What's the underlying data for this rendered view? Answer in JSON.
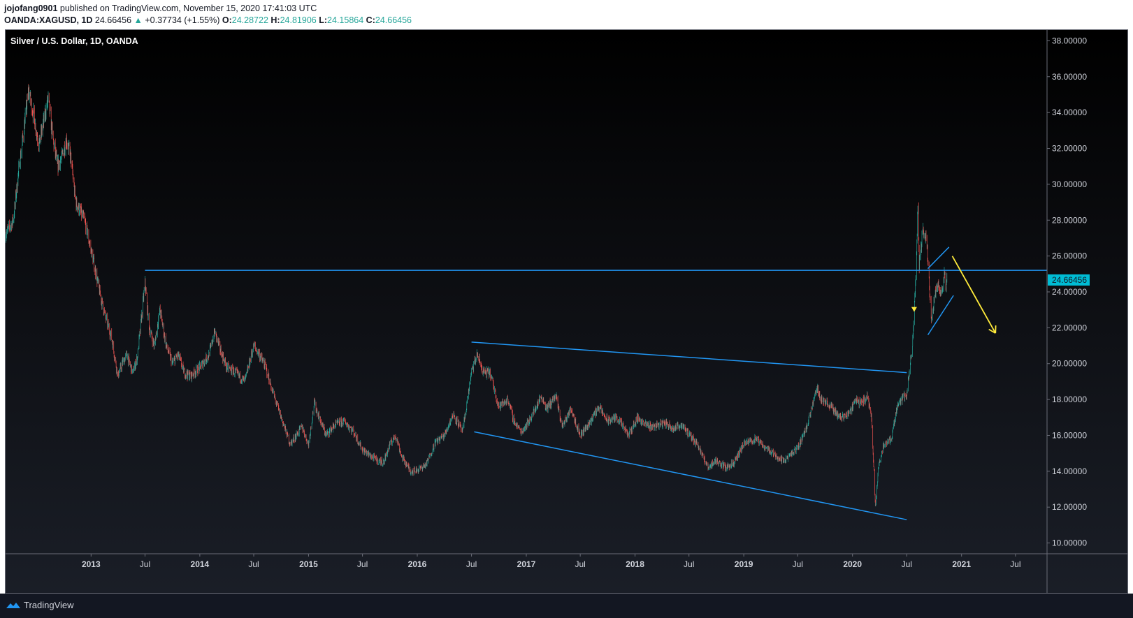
{
  "header": {
    "author": "jojofang0901",
    "published_text": "published on TradingView.com, November 15, 2020 17:41:03 UTC",
    "symbol": "OANDA:XAGUSD, 1D",
    "last_price": "24.66456",
    "change_arrow": "▲",
    "change": "+0.37734 (+1.55%)",
    "open_label": "O:",
    "open": "24.28722",
    "high_label": "H:",
    "high": "24.81906",
    "low_label": "L:",
    "low": "24.15864",
    "close_label": "C:",
    "close": "24.66456"
  },
  "footer": {
    "brand": "TradingView",
    "logo_icon": "tradingview-logo-icon"
  },
  "colors": {
    "up": "#26a69a",
    "down": "#ef5350",
    "drawing_line": "#2196f3",
    "projection_arrow": "#ffeb3b",
    "price_label_bg": "#00bcd4"
  },
  "chart_data": {
    "type": "candlestick",
    "title": "Silver / U.S. Dollar, 1D, OANDA",
    "price_axis": {
      "ticks": [
        "38.00000",
        "36.00000",
        "34.00000",
        "32.00000",
        "30.00000",
        "28.00000",
        "26.00000",
        "24.00000",
        "22.00000",
        "20.00000",
        "18.00000",
        "16.00000",
        "14.00000",
        "12.00000",
        "10.00000"
      ],
      "range": [
        9.4,
        38.6
      ],
      "last_price_label": "24.66456"
    },
    "time_axis": {
      "range": [
        "2012-03-20",
        "2021-10-15"
      ],
      "ticks": [
        {
          "date": "2013-01-01",
          "label": "2013",
          "bold": true
        },
        {
          "date": "2013-07-01",
          "label": "Jul",
          "bold": false
        },
        {
          "date": "2014-01-01",
          "label": "2014",
          "bold": true
        },
        {
          "date": "2014-07-01",
          "label": "Jul",
          "bold": false
        },
        {
          "date": "2015-01-01",
          "label": "2015",
          "bold": true
        },
        {
          "date": "2015-07-01",
          "label": "Jul",
          "bold": false
        },
        {
          "date": "2016-01-01",
          "label": "2016",
          "bold": true
        },
        {
          "date": "2016-07-01",
          "label": "Jul",
          "bold": false
        },
        {
          "date": "2017-01-01",
          "label": "2017",
          "bold": true
        },
        {
          "date": "2017-07-01",
          "label": "Jul",
          "bold": false
        },
        {
          "date": "2018-01-01",
          "label": "2018",
          "bold": true
        },
        {
          "date": "2018-07-01",
          "label": "Jul",
          "bold": false
        },
        {
          "date": "2019-01-01",
          "label": "2019",
          "bold": true
        },
        {
          "date": "2019-07-01",
          "label": "Jul",
          "bold": false
        },
        {
          "date": "2020-01-01",
          "label": "2020",
          "bold": true
        },
        {
          "date": "2020-07-01",
          "label": "Jul",
          "bold": false
        },
        {
          "date": "2021-01-01",
          "label": "2021",
          "bold": true
        },
        {
          "date": "2021-07-01",
          "label": "Jul",
          "bold": false
        }
      ]
    },
    "price_path": [
      [
        "2012-03-20",
        27.2
      ],
      [
        "2012-04-15",
        28.0
      ],
      [
        "2012-05-01",
        30.5
      ],
      [
        "2012-05-20",
        33.0
      ],
      [
        "2012-06-05",
        35.2
      ],
      [
        "2012-06-20",
        34.0
      ],
      [
        "2012-07-10",
        32.2
      ],
      [
        "2012-07-25",
        33.4
      ],
      [
        "2012-08-10",
        34.8
      ],
      [
        "2012-08-25",
        32.6
      ],
      [
        "2012-09-10",
        31.0
      ],
      [
        "2012-09-25",
        31.5
      ],
      [
        "2012-10-10",
        32.5
      ],
      [
        "2012-10-25",
        31.5
      ],
      [
        "2012-11-10",
        29.0
      ],
      [
        "2012-11-25",
        28.5
      ],
      [
        "2012-12-10",
        28.0
      ],
      [
        "2013-01-05",
        26.0
      ],
      [
        "2013-02-05",
        23.5
      ],
      [
        "2013-02-20",
        22.5
      ],
      [
        "2013-03-10",
        21.5
      ],
      [
        "2013-04-01",
        19.3
      ],
      [
        "2013-04-15",
        20.0
      ],
      [
        "2013-05-01",
        20.5
      ],
      [
        "2013-05-20",
        19.5
      ],
      [
        "2013-06-05",
        20.3
      ],
      [
        "2013-07-01",
        24.5
      ],
      [
        "2013-07-15",
        22.0
      ],
      [
        "2013-08-01",
        21.0
      ],
      [
        "2013-08-20",
        23.0
      ],
      [
        "2013-09-10",
        21.0
      ],
      [
        "2013-10-01",
        20.0
      ],
      [
        "2013-10-20",
        20.5
      ],
      [
        "2013-11-10",
        19.5
      ],
      [
        "2013-12-01",
        19.3
      ],
      [
        "2014-01-01",
        19.8
      ],
      [
        "2014-02-01",
        20.5
      ],
      [
        "2014-02-20",
        21.8
      ],
      [
        "2014-03-10",
        20.8
      ],
      [
        "2014-04-01",
        19.8
      ],
      [
        "2014-05-01",
        19.5
      ],
      [
        "2014-06-01",
        19.0
      ],
      [
        "2014-07-01",
        21.0
      ],
      [
        "2014-07-20",
        20.5
      ],
      [
        "2014-08-10",
        19.8
      ],
      [
        "2014-09-01",
        18.5
      ],
      [
        "2014-10-01",
        17.0
      ],
      [
        "2014-11-01",
        15.5
      ],
      [
        "2014-11-20",
        16.0
      ],
      [
        "2014-12-10",
        16.5
      ],
      [
        "2015-01-01",
        15.5
      ],
      [
        "2015-01-20",
        17.8
      ],
      [
        "2015-02-10",
        16.8
      ],
      [
        "2015-03-01",
        16.0
      ],
      [
        "2015-04-01",
        16.6
      ],
      [
        "2015-05-01",
        16.8
      ],
      [
        "2015-06-01",
        16.2
      ],
      [
        "2015-07-01",
        15.2
      ],
      [
        "2015-08-01",
        14.8
      ],
      [
        "2015-08-20",
        14.6
      ],
      [
        "2015-09-10",
        14.5
      ],
      [
        "2015-10-01",
        15.5
      ],
      [
        "2015-10-20",
        16.0
      ],
      [
        "2015-11-10",
        14.8
      ],
      [
        "2015-12-10",
        14.0
      ],
      [
        "2016-01-05",
        14.1
      ],
      [
        "2016-02-01",
        14.4
      ],
      [
        "2016-03-01",
        15.6
      ],
      [
        "2016-04-01",
        16.0
      ],
      [
        "2016-05-01",
        17.2
      ],
      [
        "2016-06-01",
        16.2
      ],
      [
        "2016-07-01",
        19.5
      ],
      [
        "2016-07-20",
        20.5
      ],
      [
        "2016-08-10",
        19.5
      ],
      [
        "2016-09-01",
        19.5
      ],
      [
        "2016-10-01",
        17.6
      ],
      [
        "2016-11-01",
        18.0
      ],
      [
        "2016-11-20",
        16.8
      ],
      [
        "2016-12-15",
        16.2
      ],
      [
        "2017-01-10",
        16.8
      ],
      [
        "2017-02-01",
        17.5
      ],
      [
        "2017-02-20",
        18.2
      ],
      [
        "2017-03-10",
        17.5
      ],
      [
        "2017-04-10",
        18.2
      ],
      [
        "2017-05-01",
        16.5
      ],
      [
        "2017-06-01",
        17.5
      ],
      [
        "2017-07-01",
        16.0
      ],
      [
        "2017-08-01",
        16.7
      ],
      [
        "2017-09-01",
        17.6
      ],
      [
        "2017-10-01",
        16.8
      ],
      [
        "2017-11-01",
        17.0
      ],
      [
        "2017-12-10",
        16.0
      ],
      [
        "2018-01-10",
        17.0
      ],
      [
        "2018-02-01",
        16.6
      ],
      [
        "2018-03-01",
        16.5
      ],
      [
        "2018-04-10",
        16.7
      ],
      [
        "2018-05-10",
        16.4
      ],
      [
        "2018-06-10",
        16.6
      ],
      [
        "2018-07-01",
        16.0
      ],
      [
        "2018-08-01",
        15.5
      ],
      [
        "2018-09-01",
        14.2
      ],
      [
        "2018-10-01",
        14.6
      ],
      [
        "2018-11-01",
        14.2
      ],
      [
        "2018-12-01",
        14.5
      ],
      [
        "2019-01-01",
        15.5
      ],
      [
        "2019-02-10",
        15.8
      ],
      [
        "2019-03-10",
        15.4
      ],
      [
        "2019-04-10",
        15.0
      ],
      [
        "2019-05-10",
        14.6
      ],
      [
        "2019-06-01",
        14.8
      ],
      [
        "2019-07-01",
        15.3
      ],
      [
        "2019-07-20",
        16.0
      ],
      [
        "2019-08-10",
        17.0
      ],
      [
        "2019-09-01",
        18.7
      ],
      [
        "2019-09-20",
        18.0
      ],
      [
        "2019-10-20",
        17.6
      ],
      [
        "2019-11-20",
        17.0
      ],
      [
        "2019-12-20",
        17.2
      ],
      [
        "2020-01-10",
        18.0
      ],
      [
        "2020-02-01",
        17.8
      ],
      [
        "2020-02-20",
        18.2
      ],
      [
        "2020-03-05",
        17.0
      ],
      [
        "2020-03-18",
        12.0
      ],
      [
        "2020-03-28",
        14.2
      ],
      [
        "2020-04-15",
        15.5
      ],
      [
        "2020-05-10",
        15.8
      ],
      [
        "2020-06-01",
        17.8
      ],
      [
        "2020-07-01",
        18.3
      ],
      [
        "2020-07-20",
        21.0
      ],
      [
        "2020-08-01",
        25.0
      ],
      [
        "2020-08-07",
        28.8
      ],
      [
        "2020-08-12",
        25.5
      ],
      [
        "2020-08-25",
        27.5
      ],
      [
        "2020-09-05",
        27.0
      ],
      [
        "2020-09-22",
        22.5
      ],
      [
        "2020-10-01",
        23.6
      ],
      [
        "2020-10-15",
        24.5
      ],
      [
        "2020-10-25",
        23.8
      ],
      [
        "2020-11-05",
        25.0
      ],
      [
        "2020-11-10",
        24.0
      ],
      [
        "2020-11-13",
        24.66
      ]
    ],
    "annotations": [
      {
        "type": "hline",
        "price": 25.2,
        "from": "2013-07-01",
        "to": "2021-10-15",
        "color": "#2196f3"
      },
      {
        "type": "trendline",
        "from": [
          "2016-07-01",
          21.2
        ],
        "to": [
          "2020-07-01",
          19.5
        ],
        "color": "#2196f3"
      },
      {
        "type": "trendline",
        "from": [
          "2016-07-10",
          16.2
        ],
        "to": [
          "2020-07-01",
          11.3
        ],
        "color": "#2196f3"
      },
      {
        "type": "trendline",
        "from": [
          "2020-09-10",
          25.3
        ],
        "to": [
          "2020-11-20",
          26.5
        ],
        "color": "#2196f3"
      },
      {
        "type": "trendline",
        "from": [
          "2020-09-10",
          21.6
        ],
        "to": [
          "2020-12-05",
          23.8
        ],
        "color": "#2196f3"
      },
      {
        "type": "arrow",
        "from": [
          "2020-12-01",
          26.0
        ],
        "to": [
          "2021-04-25",
          21.7
        ],
        "color": "#ffeb3b"
      },
      {
        "type": "marker",
        "at": [
          "2020-07-26",
          23.0
        ],
        "shape": "triangle-down",
        "color": "#ffeb3b"
      }
    ]
  }
}
